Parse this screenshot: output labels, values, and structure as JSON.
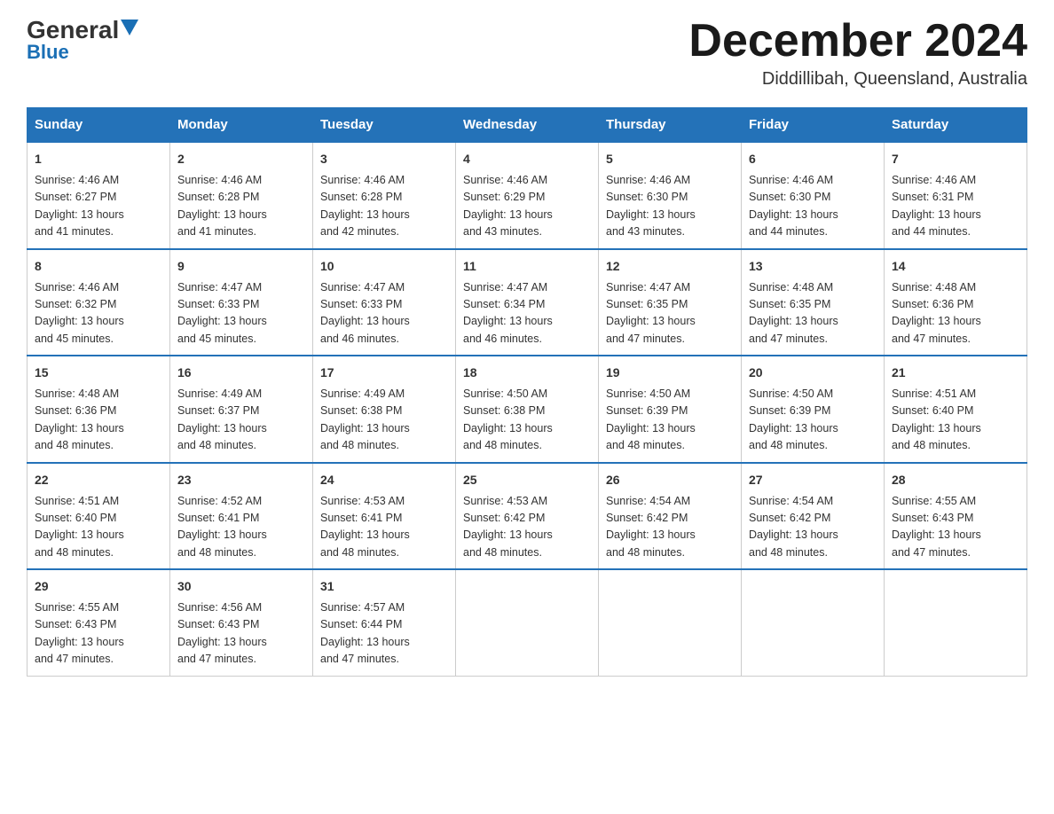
{
  "logo": {
    "general": "General",
    "blue": "Blue"
  },
  "header": {
    "month": "December 2024",
    "location": "Diddillibah, Queensland, Australia"
  },
  "weekdays": [
    "Sunday",
    "Monday",
    "Tuesday",
    "Wednesday",
    "Thursday",
    "Friday",
    "Saturday"
  ],
  "weeks": [
    [
      {
        "day": "1",
        "sunrise": "4:46 AM",
        "sunset": "6:27 PM",
        "daylight": "13 hours and 41 minutes."
      },
      {
        "day": "2",
        "sunrise": "4:46 AM",
        "sunset": "6:28 PM",
        "daylight": "13 hours and 41 minutes."
      },
      {
        "day": "3",
        "sunrise": "4:46 AM",
        "sunset": "6:28 PM",
        "daylight": "13 hours and 42 minutes."
      },
      {
        "day": "4",
        "sunrise": "4:46 AM",
        "sunset": "6:29 PM",
        "daylight": "13 hours and 43 minutes."
      },
      {
        "day": "5",
        "sunrise": "4:46 AM",
        "sunset": "6:30 PM",
        "daylight": "13 hours and 43 minutes."
      },
      {
        "day": "6",
        "sunrise": "4:46 AM",
        "sunset": "6:30 PM",
        "daylight": "13 hours and 44 minutes."
      },
      {
        "day": "7",
        "sunrise": "4:46 AM",
        "sunset": "6:31 PM",
        "daylight": "13 hours and 44 minutes."
      }
    ],
    [
      {
        "day": "8",
        "sunrise": "4:46 AM",
        "sunset": "6:32 PM",
        "daylight": "13 hours and 45 minutes."
      },
      {
        "day": "9",
        "sunrise": "4:47 AM",
        "sunset": "6:33 PM",
        "daylight": "13 hours and 45 minutes."
      },
      {
        "day": "10",
        "sunrise": "4:47 AM",
        "sunset": "6:33 PM",
        "daylight": "13 hours and 46 minutes."
      },
      {
        "day": "11",
        "sunrise": "4:47 AM",
        "sunset": "6:34 PM",
        "daylight": "13 hours and 46 minutes."
      },
      {
        "day": "12",
        "sunrise": "4:47 AM",
        "sunset": "6:35 PM",
        "daylight": "13 hours and 47 minutes."
      },
      {
        "day": "13",
        "sunrise": "4:48 AM",
        "sunset": "6:35 PM",
        "daylight": "13 hours and 47 minutes."
      },
      {
        "day": "14",
        "sunrise": "4:48 AM",
        "sunset": "6:36 PM",
        "daylight": "13 hours and 47 minutes."
      }
    ],
    [
      {
        "day": "15",
        "sunrise": "4:48 AM",
        "sunset": "6:36 PM",
        "daylight": "13 hours and 48 minutes."
      },
      {
        "day": "16",
        "sunrise": "4:49 AM",
        "sunset": "6:37 PM",
        "daylight": "13 hours and 48 minutes."
      },
      {
        "day": "17",
        "sunrise": "4:49 AM",
        "sunset": "6:38 PM",
        "daylight": "13 hours and 48 minutes."
      },
      {
        "day": "18",
        "sunrise": "4:50 AM",
        "sunset": "6:38 PM",
        "daylight": "13 hours and 48 minutes."
      },
      {
        "day": "19",
        "sunrise": "4:50 AM",
        "sunset": "6:39 PM",
        "daylight": "13 hours and 48 minutes."
      },
      {
        "day": "20",
        "sunrise": "4:50 AM",
        "sunset": "6:39 PM",
        "daylight": "13 hours and 48 minutes."
      },
      {
        "day": "21",
        "sunrise": "4:51 AM",
        "sunset": "6:40 PM",
        "daylight": "13 hours and 48 minutes."
      }
    ],
    [
      {
        "day": "22",
        "sunrise": "4:51 AM",
        "sunset": "6:40 PM",
        "daylight": "13 hours and 48 minutes."
      },
      {
        "day": "23",
        "sunrise": "4:52 AM",
        "sunset": "6:41 PM",
        "daylight": "13 hours and 48 minutes."
      },
      {
        "day": "24",
        "sunrise": "4:53 AM",
        "sunset": "6:41 PM",
        "daylight": "13 hours and 48 minutes."
      },
      {
        "day": "25",
        "sunrise": "4:53 AM",
        "sunset": "6:42 PM",
        "daylight": "13 hours and 48 minutes."
      },
      {
        "day": "26",
        "sunrise": "4:54 AM",
        "sunset": "6:42 PM",
        "daylight": "13 hours and 48 minutes."
      },
      {
        "day": "27",
        "sunrise": "4:54 AM",
        "sunset": "6:42 PM",
        "daylight": "13 hours and 48 minutes."
      },
      {
        "day": "28",
        "sunrise": "4:55 AM",
        "sunset": "6:43 PM",
        "daylight": "13 hours and 47 minutes."
      }
    ],
    [
      {
        "day": "29",
        "sunrise": "4:55 AM",
        "sunset": "6:43 PM",
        "daylight": "13 hours and 47 minutes."
      },
      {
        "day": "30",
        "sunrise": "4:56 AM",
        "sunset": "6:43 PM",
        "daylight": "13 hours and 47 minutes."
      },
      {
        "day": "31",
        "sunrise": "4:57 AM",
        "sunset": "6:44 PM",
        "daylight": "13 hours and 47 minutes."
      },
      null,
      null,
      null,
      null
    ]
  ],
  "labels": {
    "sunrise": "Sunrise: ",
    "sunset": "Sunset: ",
    "daylight": "Daylight: "
  }
}
